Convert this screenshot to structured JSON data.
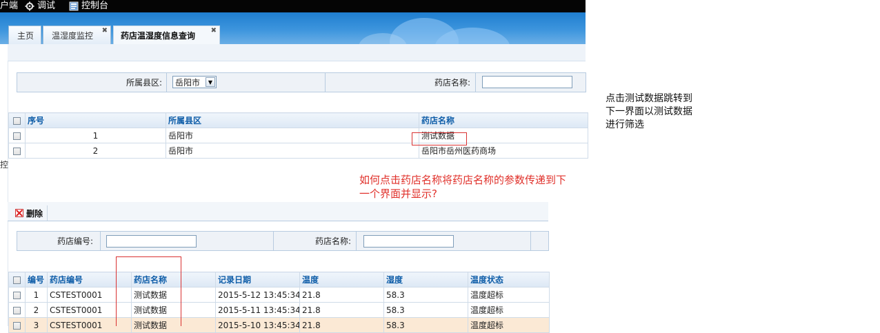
{
  "menubar": {
    "items": [
      {
        "label": "户端",
        "icon": "client-icon"
      },
      {
        "label": "调试",
        "icon": "debug-gear-icon"
      },
      {
        "label": "控制台",
        "icon": "console-monitor-icon"
      }
    ]
  },
  "tabs": [
    {
      "label": "主页",
      "closable": false,
      "active": false
    },
    {
      "label": "温湿度监控",
      "closable": true,
      "active": false
    },
    {
      "label": "药店温湿度信息查询",
      "closable": true,
      "active": true
    }
  ],
  "sidebar_fragment": "控",
  "top_search": {
    "county_label": "所属县区:",
    "county_value": "岳阳市",
    "pharmacy_name_label": "药店名称:",
    "pharmacy_name_value": ""
  },
  "top_table": {
    "columns": [
      "序号",
      "所属县区",
      "药店名称"
    ],
    "rows": [
      {
        "index": "1",
        "county": "岳阳市",
        "pharmacy": "测试数据"
      },
      {
        "index": "2",
        "county": "岳阳市",
        "pharmacy": "岳阳市岳州医药商场"
      }
    ]
  },
  "annotation_red": [
    "如何点击药店名称将药店名称的参数传递到下",
    "一个界面并显示?"
  ],
  "annotation_black": [
    "点击测试数据跳转到",
    "下一界面以测试数据",
    "进行筛选"
  ],
  "toolbar": {
    "delete_label": "删除"
  },
  "bottom_search": {
    "code_label": "药店编号:",
    "code_value": "",
    "name_label": "药店名称:",
    "name_value": ""
  },
  "bottom_table": {
    "columns": [
      "编号",
      "药店编号",
      "药店名称",
      "记录日期",
      "温度",
      "湿度",
      "温度状态"
    ],
    "rows": [
      {
        "no": "1",
        "code": "CSTEST0001",
        "name": "测试数据",
        "date": "2015-5-12 13:45:34",
        "temp": "21.8",
        "humidity": "58.3",
        "status": "温度超标"
      },
      {
        "no": "2",
        "code": "CSTEST0001",
        "name": "测试数据",
        "date": "2015-5-11 13:45:34",
        "temp": "21.8",
        "humidity": "58.3",
        "status": "温度超标"
      },
      {
        "no": "3",
        "code": "CSTEST0001",
        "name": "测试数据",
        "date": "2015-5-10 13:45:34",
        "temp": "21.8",
        "humidity": "58.3",
        "status": "温度超标"
      }
    ]
  },
  "colors": {
    "header_blue": "#1f7ed0",
    "warning_red": "#c00000",
    "annotation_red": "#e0302a"
  }
}
